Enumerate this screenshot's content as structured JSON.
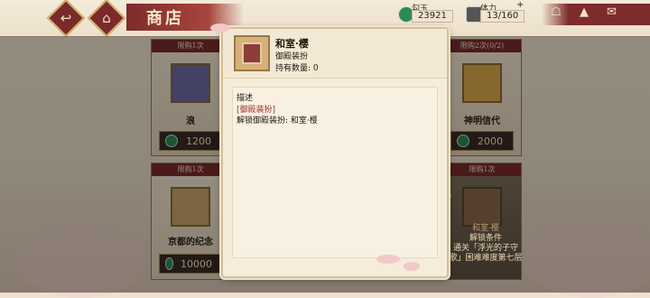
{
  "header": {
    "title": "商店",
    "back_label": "back",
    "home_label": "home"
  },
  "currency": {
    "jade_label": "勾玉",
    "jade_value": "23921",
    "stamina_label": "体力",
    "stamina_value": "13/160",
    "plus": "+"
  },
  "cards": [
    {
      "limit": "限购1次",
      "name": "浪",
      "price": "1200"
    },
    {
      "limit": "限购2次(0/2)",
      "name": "神明信代",
      "price": "2000"
    },
    {
      "limit": "限购1次",
      "name": "京都的纪念",
      "price": "10000"
    },
    {
      "limit": "限购1次",
      "name": "和室·樱",
      "price": ""
    }
  ],
  "unlock": {
    "title": "解锁条件",
    "text": "通关「浮光的子守歌」困难难度第七层"
  },
  "popup": {
    "title": "和室·樱",
    "subtitle": "御殿装扮",
    "count": "持有数量: 0",
    "desc_label": "描述",
    "desc_tag": "[御殿装扮]",
    "desc_text": "解锁御殿装扮: 和室·樱"
  },
  "colors": {
    "accent": "#7a2a2a",
    "gold": "#d4b06a",
    "jade": "#2e8a52"
  }
}
